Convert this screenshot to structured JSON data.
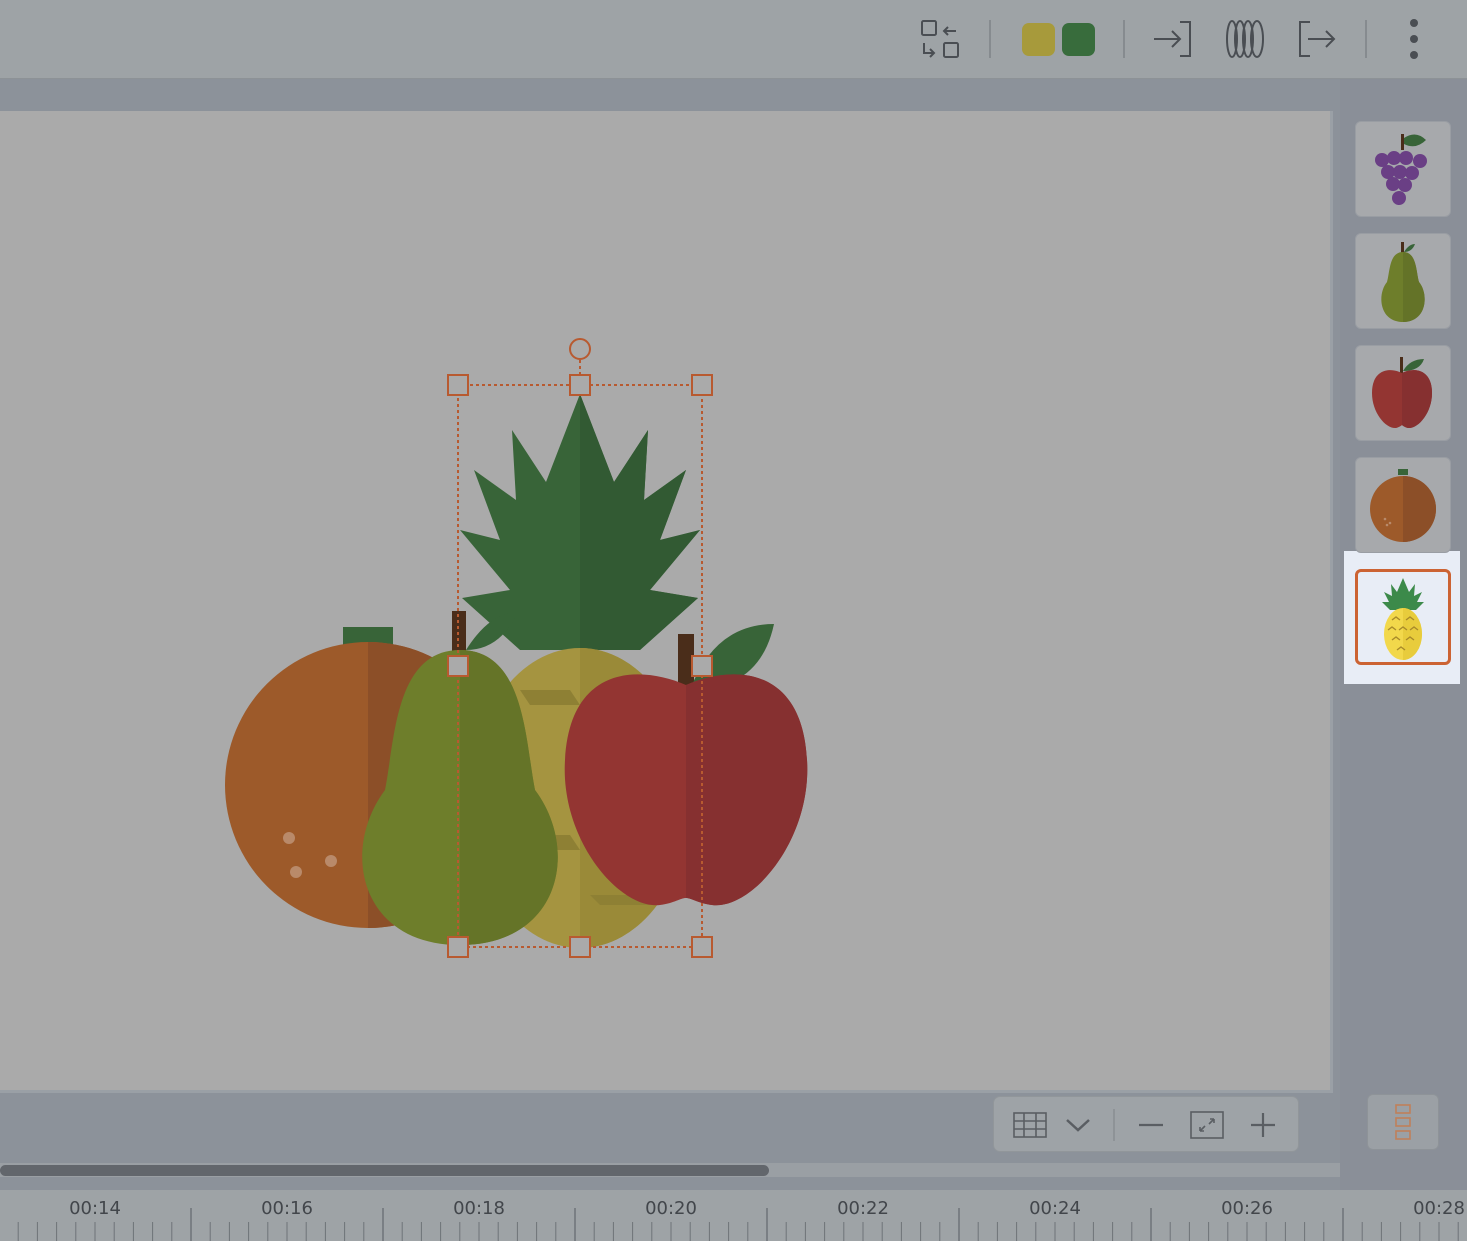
{
  "toolbar": {
    "swap_icon": "swap-position-icon",
    "swatches": [
      {
        "name": "olive-yellow",
        "color": "#a79a3b"
      },
      {
        "name": "forest-green",
        "color": "#386c3c"
      }
    ],
    "buttons": [
      "enter-animation-icon",
      "motion-effect-icon",
      "exit-animation-icon",
      "more-options-icon"
    ]
  },
  "thumbnails": [
    {
      "name": "grapes",
      "selected": false
    },
    {
      "name": "pear",
      "selected": false
    },
    {
      "name": "apple",
      "selected": false
    },
    {
      "name": "orange",
      "selected": false
    },
    {
      "name": "pineapple",
      "selected": true
    }
  ],
  "canvas": {
    "selected_element": "pineapple",
    "colors": {
      "selection": "#b85a30",
      "orange": "#9d5a2a",
      "pear": "#6e7e2b",
      "apple": "#933532",
      "pineapple_leaf": "#386438",
      "pineapple_body": "#a59440"
    }
  },
  "zoom_bar": {
    "icons": [
      "grid-icon",
      "chevron-down-icon",
      "zoom-out-icon",
      "fit-screen-icon",
      "zoom-in-icon"
    ]
  },
  "scrollbar": {
    "position": 0.57
  },
  "timeline": {
    "labels": [
      "00:14",
      "00:16",
      "00:18",
      "00:20",
      "00:22",
      "00:24",
      "00:26",
      "00:28"
    ]
  }
}
